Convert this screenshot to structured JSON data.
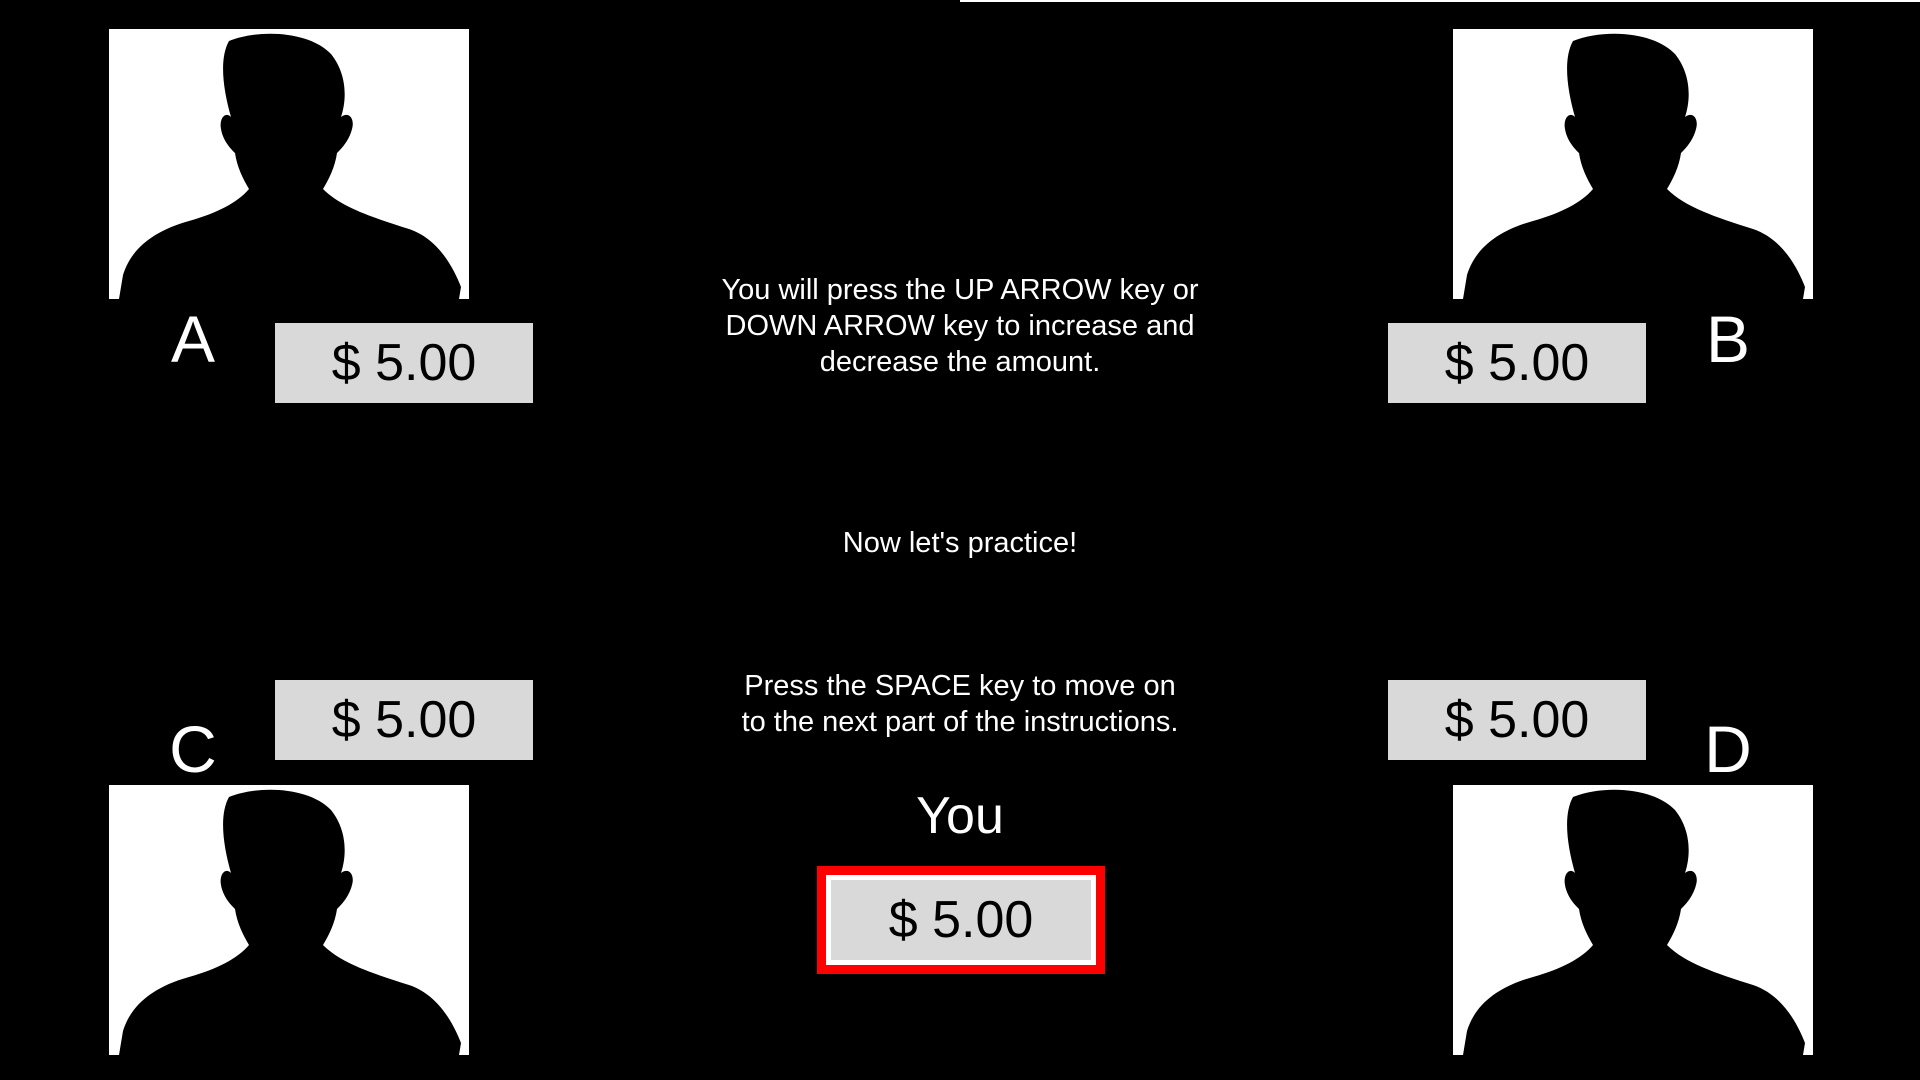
{
  "players": {
    "a": {
      "letter": "A",
      "amount": "$ 5.00"
    },
    "b": {
      "letter": "B",
      "amount": "$ 5.00"
    },
    "c": {
      "letter": "C",
      "amount": "$ 5.00"
    },
    "d": {
      "letter": "D",
      "amount": "$ 5.00"
    }
  },
  "you": {
    "label": "You",
    "amount": "$ 5.00"
  },
  "instructions": {
    "arrows": "You will press the UP ARROW key or\nDOWN ARROW key to increase and\ndecrease the amount.",
    "practice": "Now let's practice!",
    "space": "Press the SPACE key to move on\nto the next part of the instructions."
  },
  "icons": {
    "player_photo": "person-silhouette-icon"
  },
  "colors": {
    "background": "#000000",
    "amount_box": "#d9d9d9",
    "selected_border": "#ff0000"
  }
}
